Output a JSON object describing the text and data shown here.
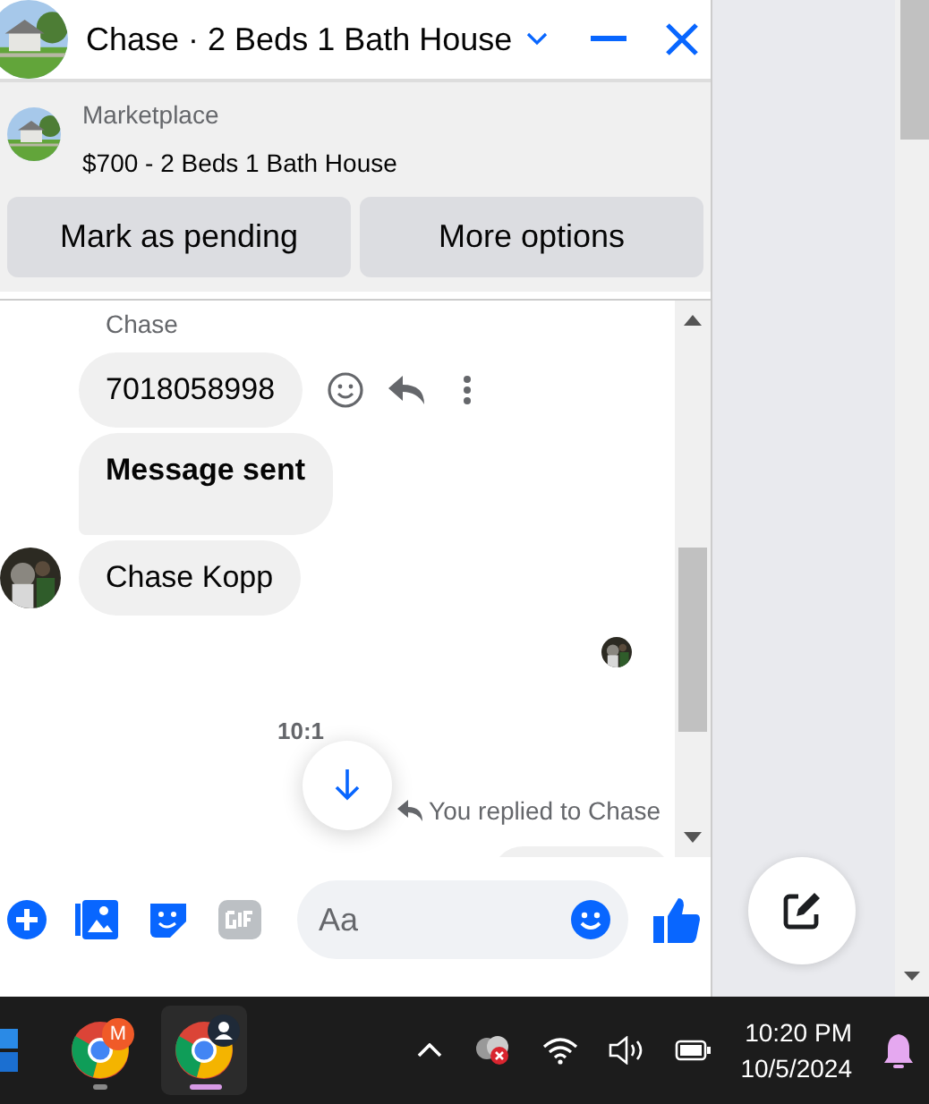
{
  "header": {
    "title": "Chase · 2 Beds 1 Bath House"
  },
  "listing": {
    "label": "Marketplace",
    "title": "$700 - 2 Beds 1 Bath House",
    "buttons": [
      "Mark as pending",
      "More options"
    ]
  },
  "messages": [
    {
      "kind": "sender",
      "text": "Chase"
    },
    {
      "kind": "bubble",
      "text": "7018058998",
      "bold": false,
      "hovered": true,
      "avatar": false
    },
    {
      "kind": "bubble",
      "text": "Message sent",
      "bold": true,
      "hovered": false,
      "avatar": false
    },
    {
      "kind": "bubble",
      "text": "Chase Kopp",
      "bold": false,
      "hovered": false,
      "avatar": true
    },
    {
      "kind": "seen"
    },
    {
      "kind": "time",
      "text": "10:1"
    },
    {
      "kind": "reply-note",
      "text": "You replied to Chase"
    }
  ],
  "composer": {
    "placeholder": "Aa"
  },
  "taskbar": {
    "apps": [
      {
        "badge": "M",
        "selected": false
      },
      {
        "selected": true
      }
    ],
    "time": "10:20 PM",
    "date": "10/5/2024"
  }
}
